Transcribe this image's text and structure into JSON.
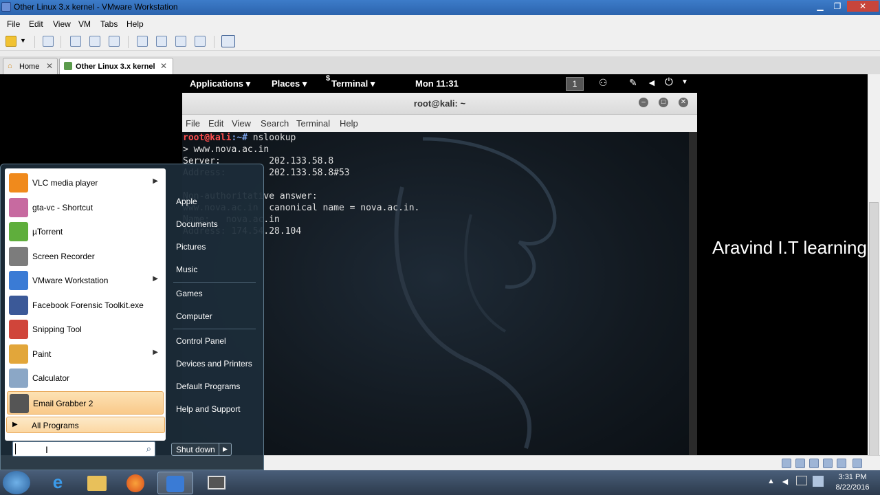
{
  "window": {
    "title": "Other Linux 3.x kernel - VMware Workstation"
  },
  "menubar": [
    "File",
    "Edit",
    "View",
    "VM",
    "Tabs",
    "Help"
  ],
  "tabs": [
    {
      "label": "Home"
    },
    {
      "label": "Other Linux 3.x kernel"
    }
  ],
  "gnome": {
    "applications": "Applications ▾",
    "places": "Places ▾",
    "terminal": "Terminal ▾",
    "clock": "Mon 11:31",
    "workspace": "1"
  },
  "terminal": {
    "title": "root@kali: ~",
    "menu": [
      "File",
      "Edit",
      "View",
      "Search",
      "Terminal",
      "Help"
    ],
    "prompt_user": "root@kali",
    "prompt_path": ":~# ",
    "command": "nslookup",
    "lines": [
      "> www.nova.ac.in",
      "Server:         202.133.58.8",
      "Address:        202.133.58.8#53",
      "",
      "Non-authoritative answer:",
      "www.nova.ac.in  canonical name = nova.ac.in.",
      "Name:   nova.ac.in",
      "Address: 174.54.28.104"
    ]
  },
  "watermark": "Aravind  I.T learning",
  "startmenu": {
    "programs": [
      {
        "label": "VLC media player",
        "has_submenu": true,
        "icon": "vlc-icon",
        "color": "#f08a1c"
      },
      {
        "label": "gta-vc - Shortcut",
        "has_submenu": false,
        "icon": "gta-icon",
        "color": "#c76aa0"
      },
      {
        "label": "µTorrent",
        "has_submenu": false,
        "icon": "utorrent-icon",
        "color": "#5fae3c"
      },
      {
        "label": "Screen Recorder",
        "has_submenu": false,
        "icon": "screen-recorder-icon",
        "color": "#7c7c7c"
      },
      {
        "label": "VMware Workstation",
        "has_submenu": true,
        "icon": "vmware-icon",
        "color": "#3a7bd5"
      },
      {
        "label": "Facebook Forensic Toolkit.exe",
        "has_submenu": false,
        "icon": "facebook-icon",
        "color": "#3b5998"
      },
      {
        "label": "Snipping Tool",
        "has_submenu": false,
        "icon": "scissors-icon",
        "color": "#d0453a"
      },
      {
        "label": "Paint",
        "has_submenu": true,
        "icon": "paint-icon",
        "color": "#e2a63a"
      },
      {
        "label": "Calculator",
        "has_submenu": false,
        "icon": "calculator-icon",
        "color": "#8ba7c6"
      },
      {
        "label": "Email Grabber 2",
        "has_submenu": false,
        "icon": "email-grabber-icon",
        "color": "#555555"
      }
    ],
    "all_programs": "All Programs",
    "search_placeholder": "",
    "right_items": [
      "Apple",
      "Documents",
      "Pictures",
      "Music",
      "Games",
      "Computer",
      "Control Panel",
      "Devices and Printers",
      "Default Programs",
      "Help and Support"
    ],
    "shutdown": "Shut down"
  },
  "taskbar": {
    "time": "3:31 PM",
    "date": "8/22/2016"
  }
}
